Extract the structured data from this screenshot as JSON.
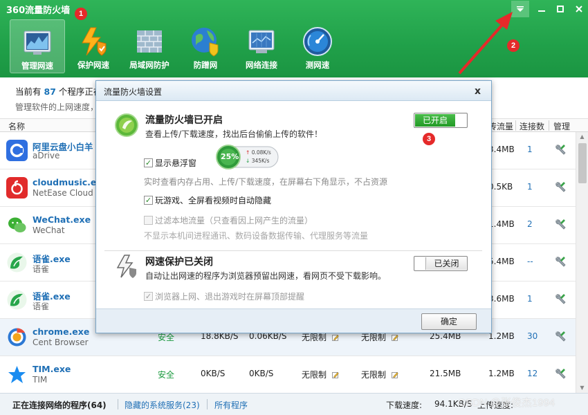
{
  "app": {
    "title": "360流量防火墙",
    "markers": [
      "1",
      "2",
      "3"
    ]
  },
  "toolbar": [
    {
      "label": "管理网速",
      "icon": "monitor-chart-icon",
      "active": true
    },
    {
      "label": "保护网速",
      "icon": "lightning-shield-icon",
      "active": false
    },
    {
      "label": "局域网防护",
      "icon": "brick-wall-icon",
      "active": false
    },
    {
      "label": "防蹭网",
      "icon": "globe-shield-icon",
      "active": false
    },
    {
      "label": "网络连接",
      "icon": "network-screen-icon",
      "active": false
    },
    {
      "label": "测网速",
      "icon": "speedometer-icon",
      "active": false
    }
  ],
  "info": {
    "line1_prefix": "当前有",
    "program_count": "87",
    "line1_suffix": "个程序正在",
    "line2": "管理软件的上网速度，"
  },
  "columns": {
    "name": "名称",
    "flow": "传流量",
    "connections": "连接数",
    "manage": "管理"
  },
  "rows": [
    {
      "name": "阿里云盘小白羊",
      "sub": "aDrive",
      "icon": "adrive-icon",
      "status": "",
      "down": "",
      "up": "",
      "down_limit": "",
      "up_limit": "",
      "download_total": "",
      "upload_total": "3.4MB",
      "conn": "1",
      "highlight": false
    },
    {
      "name": "cloudmusic.exe",
      "sub": "NetEase Cloud M",
      "icon": "netease-music-icon",
      "status": "",
      "down": "",
      "up": "",
      "down_limit": "",
      "up_limit": "",
      "download_total": "",
      "upload_total": "0.5KB",
      "conn": "1",
      "highlight": false
    },
    {
      "name": "WeChat.exe",
      "sub": "WeChat",
      "icon": "wechat-icon",
      "status": "",
      "down": "",
      "up": "",
      "down_limit": "",
      "up_limit": "",
      "download_total": "",
      "upload_total": "1.4MB",
      "conn": "2",
      "highlight": false
    },
    {
      "name": "语雀.exe",
      "sub": "语雀",
      "icon": "yuque-icon",
      "status": "",
      "down": "",
      "up": "",
      "down_limit": "",
      "up_limit": "",
      "download_total": "",
      "upload_total": "5.4MB",
      "conn": "--",
      "highlight": false
    },
    {
      "name": "语雀.exe",
      "sub": "语雀",
      "icon": "yuque-icon",
      "status": "",
      "down": "",
      "up": "",
      "down_limit": "",
      "up_limit": "",
      "download_total": "",
      "upload_total": "3.6MB",
      "conn": "1",
      "highlight": false
    },
    {
      "name": "chrome.exe",
      "sub": "Cent Browser",
      "icon": "chrome-icon",
      "status": "安全",
      "down": "18.8KB/S",
      "up": "0.06KB/S",
      "down_limit": "无限制",
      "up_limit": "无限制",
      "download_total": "25.4MB",
      "upload_total": "1.2MB",
      "conn": "30",
      "highlight": true
    },
    {
      "name": "TIM.exe",
      "sub": "TIM",
      "icon": "tim-icon",
      "status": "安全",
      "down": "0KB/S",
      "up": "0KB/S",
      "down_limit": "无限制",
      "up_limit": "无限制",
      "download_total": "21.5MB",
      "upload_total": "1.2MB",
      "conn": "12",
      "highlight": false
    }
  ],
  "statusbar": {
    "connected": "正在连接网络的程序(64)",
    "hidden": "隐藏的系统服务(23)",
    "all": "所有程序",
    "down_label": "下载速度:",
    "down_value": "94.1KB/S",
    "up_label": "上传速度:",
    "watermark": "CSDN @张俊杰1994"
  },
  "dialog": {
    "title": "流量防火墙设置",
    "close": "x",
    "sec1_title": "流量防火墙已开启",
    "sec1_desc": "查看上传/下载速度，找出后台偷偷上传的软件！",
    "sec1_toggle": "已开启",
    "float_label": "显示悬浮窗",
    "float_checked": true,
    "float_percent": "25%",
    "float_up": "0.08K/s",
    "float_down": "345K/s",
    "float_note": "实时查看内存占用、上传/下载速度，在屏幕右下角显示，不占资源",
    "game_label": "玩游戏、全屏看视频时自动隐藏",
    "game_checked": true,
    "filter_label": "过滤本地流量（只查看因上网产生的流量）",
    "filter_checked": false,
    "filter_note": "不显示本机间进程通讯、数码设备数据传输、代理服务等流量",
    "sec2_title": "网速保护已关闭",
    "sec2_desc": "自动让出网速的程序为浏览器预留出网速，看网页不受下载影响。",
    "sec2_toggle": "已关闭",
    "browser_label": "浏览器上网、退出游戏时在屏幕顶部提醒",
    "browser_checked": true,
    "ok": "确定"
  },
  "colors": {
    "header_green": "#22a34b",
    "link_blue": "#1f6fb5",
    "safe_green": "#1a9a3e",
    "toggle_on": "#2ca52f",
    "marker_red": "#e52a2a"
  }
}
